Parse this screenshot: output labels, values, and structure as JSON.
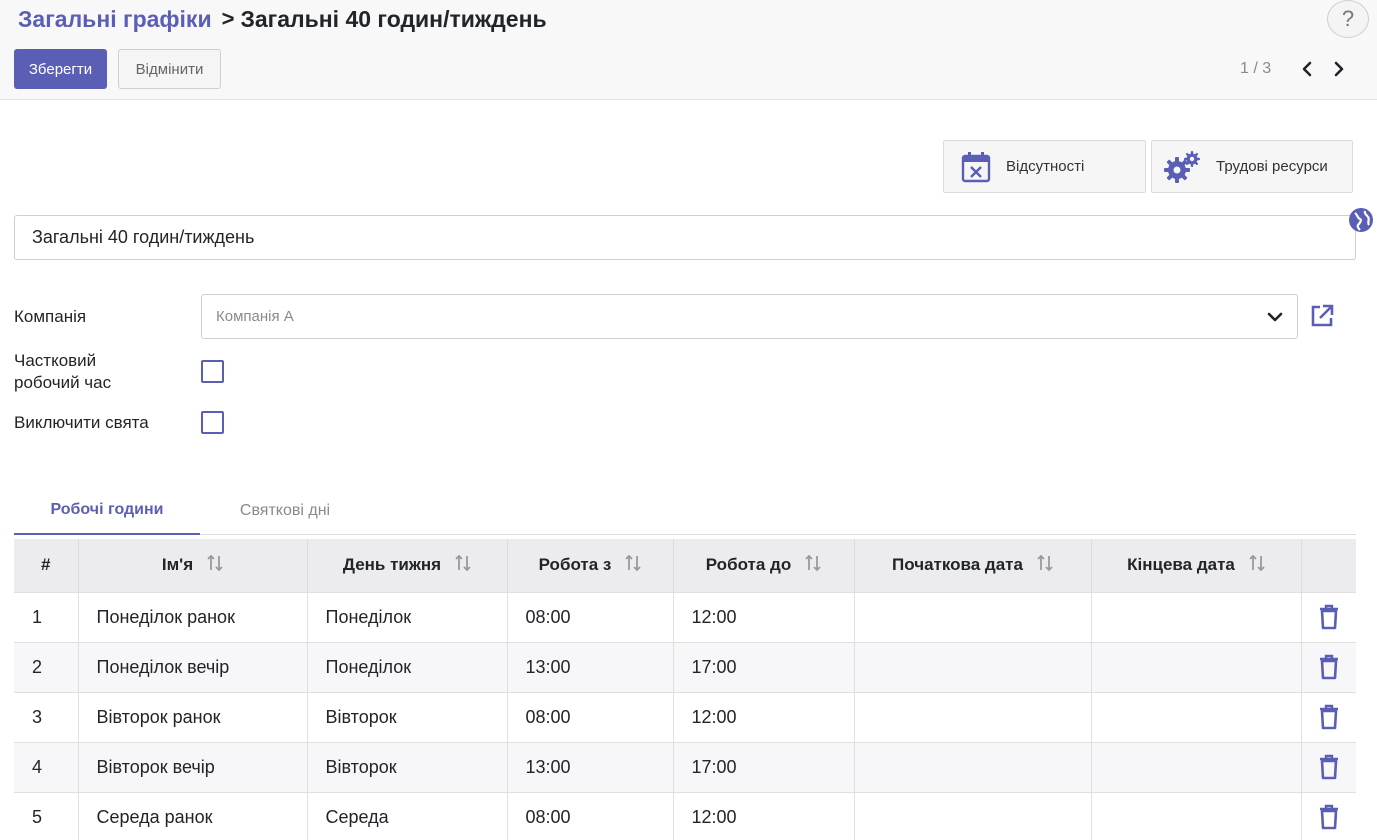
{
  "breadcrumb": {
    "parent": "Загальні графіки",
    "separator": ">",
    "current": "Загальні 40 годин/тиждень"
  },
  "help_label": "?",
  "toolbar": {
    "save_label": "Зберегти",
    "cancel_label": "Відмінити"
  },
  "pager": {
    "value": "1 / 3"
  },
  "smart_buttons": {
    "absences": "Відсутності",
    "resources": "Трудові ресурси"
  },
  "form": {
    "name_value": "Загальні 40 годин/тиждень",
    "company_label": "Компанія",
    "company_value": "Компанія A",
    "flexible_label_line1": "Частковий",
    "flexible_label_line2": "робочий час",
    "flexible_checked": false,
    "exclude_label": "Виключити свята",
    "exclude_checked": false
  },
  "tabs": {
    "working_hours": "Робочі години",
    "holidays": "Святкові дні"
  },
  "table": {
    "headers": [
      "#",
      "Ім'я",
      "День тижня",
      "Робота з",
      "Робота до",
      "Початкова дата",
      "Кінцева дата"
    ],
    "rows": [
      {
        "num": "1",
        "name": "Понеділок ранок",
        "day": "Понеділок",
        "from": "08:00",
        "to": "12:00",
        "start": "",
        "end": ""
      },
      {
        "num": "2",
        "name": "Понеділок вечір",
        "day": "Понеділок",
        "from": "13:00",
        "to": "17:00",
        "start": "",
        "end": ""
      },
      {
        "num": "3",
        "name": "Вівторок ранок",
        "day": "Вівторок",
        "from": "08:00",
        "to": "12:00",
        "start": "",
        "end": ""
      },
      {
        "num": "4",
        "name": "Вівторок вечір",
        "day": "Вівторок",
        "from": "13:00",
        "to": "17:00",
        "start": "",
        "end": ""
      },
      {
        "num": "5",
        "name": "Середа ранок",
        "day": "Середа",
        "from": "08:00",
        "to": "12:00",
        "start": "",
        "end": ""
      }
    ]
  },
  "colors": {
    "accent": "#5a5fb5",
    "header_bg": "#ececef",
    "panel_bg": "#f8f8f8"
  },
  "icons": {
    "absences": "calendar-x-icon",
    "resources": "gears-icon",
    "globe": "globe-icon",
    "external": "external-link-icon",
    "caret": "chevron-down-icon",
    "sort": "sort-icon",
    "delete": "trash-icon",
    "prev": "chevron-left-icon",
    "next": "chevron-right-icon"
  }
}
